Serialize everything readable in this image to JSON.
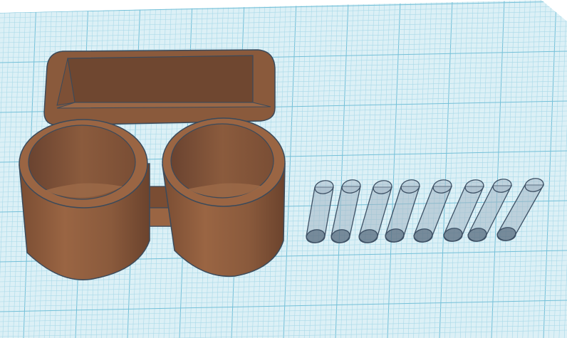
{
  "workplane": {
    "background": "#ffffff",
    "grid_fill": "#dcf0f6",
    "minor_line_color": "#a9d9e8",
    "major_line_color": "#74c0d8"
  },
  "objects": {
    "cup_holder": {
      "icon": "cup-holder-model",
      "body_color": "#8a5a3c",
      "shade_color": "#6f4730",
      "light_color": "#a06a47",
      "edge_color": "#3b4a5a"
    },
    "pegs": {
      "icon": "cylinder-hole-shape",
      "count": 8,
      "fill_color": "#a3b6c5",
      "edge_color": "#3d5064"
    }
  }
}
